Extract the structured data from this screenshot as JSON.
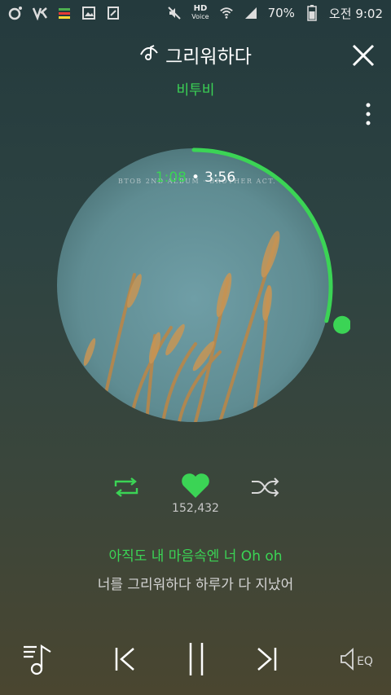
{
  "status": {
    "hd_label": "HD",
    "voice_label": "Voice",
    "battery": "70%",
    "ampm": "오전",
    "time": "9:02"
  },
  "song": {
    "title": "그리워하다",
    "artist": "비투비",
    "album_art_text": "BTOB 2ND ALBUM · BROTHER ACT."
  },
  "player": {
    "elapsed": "1:08",
    "duration": "3:56",
    "progress": 0.29,
    "likes": "152,432",
    "accent": "#3bd455"
  },
  "lyrics": {
    "current": "아직도 내 마음속엔 너 Oh oh",
    "next": "너를 그리워하다 하루가 다 지났어"
  },
  "bottom": {
    "eq_label": "EQ"
  }
}
